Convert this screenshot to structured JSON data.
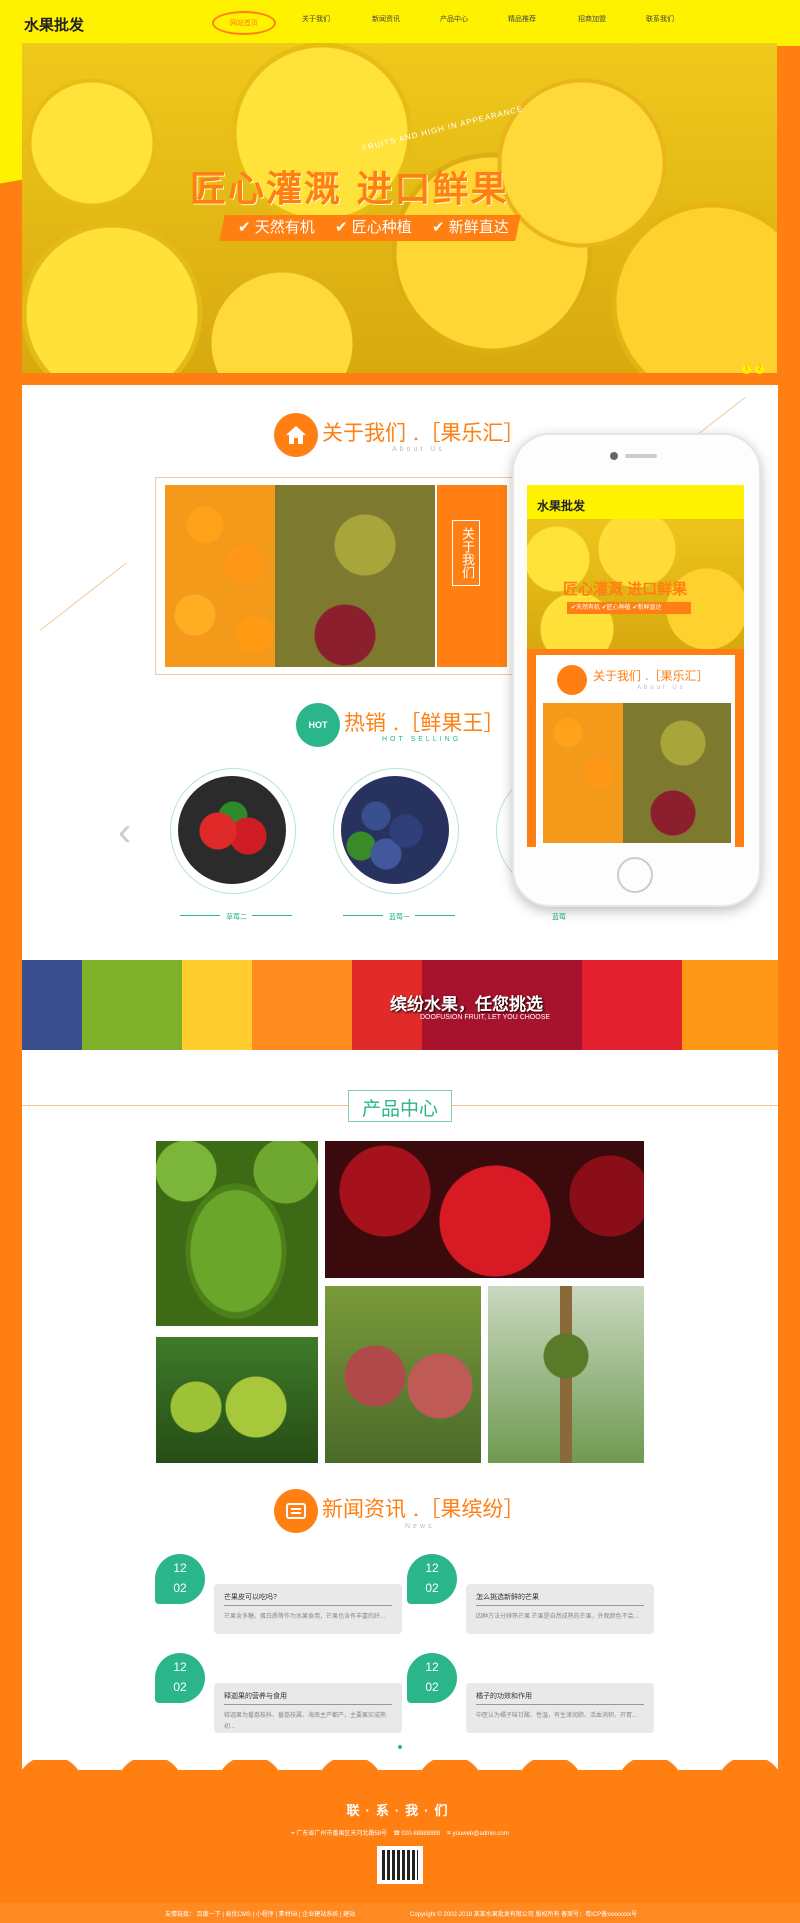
{
  "header": {
    "logo": "水果批发",
    "nav": [
      "网站首页",
      "关于我们",
      "新闻资讯",
      "产品中心",
      "精品推荐",
      "招商加盟",
      "联系我们"
    ]
  },
  "hero": {
    "title": "匠心灌溉 进口鲜果",
    "features": [
      "天然有机",
      "匠心种植",
      "新鲜直达"
    ],
    "english": "FRUITS AND HIGH IN APPEARANCE",
    "dots": [
      "1",
      "2"
    ]
  },
  "about": {
    "title": "关于我们 .［果乐汇］",
    "english": "About Us",
    "side_title": "关于我们"
  },
  "phone": {
    "logo": "水果批发",
    "hero_title": "匠心灌溉 进口鲜果",
    "hero_features": [
      "天然有机",
      "匠心种植",
      "新鲜直达"
    ],
    "about_title": "关于我们 .［果乐汇］",
    "about_en": "About Us"
  },
  "hot": {
    "title": "热销 .［鲜果王］",
    "english": "HOT SELLING",
    "icon_text": "HOT",
    "items": [
      {
        "name": "草莓二"
      },
      {
        "name": "蓝莓一"
      },
      {
        "name": "蓝莓"
      }
    ]
  },
  "banner": {
    "title": "缤纷水果，任您挑选",
    "english": "DOOFUSION FRUIT, LET YOU CHOOSE"
  },
  "products": {
    "title": "产品中心"
  },
  "news": {
    "title": "新闻资讯 .［果缤纷］",
    "english": "News",
    "items": [
      {
        "month": "12",
        "day": "02",
        "title": "芒果皮可以吃吗?",
        "desc": "芒果含多糖、蛋白质等作为水果食用，芒果也含有丰富的纤..."
      },
      {
        "month": "12",
        "day": "02",
        "title": "怎么挑选新鲜的芒果",
        "desc": "四种方法分辨熟芒果 芒果是自然成熟的芒果，外观颜色不会..."
      },
      {
        "month": "12",
        "day": "02",
        "title": "释迦果的营养与食用",
        "desc": "释迦果为番荔枝科、番荔枝属、海南主产都产，主要果实成熟初..."
      },
      {
        "month": "12",
        "day": "02",
        "title": "橘子的功效和作用",
        "desc": "中医认为橘子味甘酸、性温，有生津润肺、活血消积、开胃..."
      }
    ]
  },
  "footer": {
    "title": "联·系·我·们",
    "address": "广东省广州市番禺区天河北路58号",
    "phone": "020-88888888",
    "email": "youweb@admin.com",
    "links": "友情链接： 百度一下 | 易优CMS | 小程序 | 素材58 | 企业建站系统 | 建站",
    "copyright": "Copyright © 2002-2018 某某水果批发有限公司 版权所有 备案号：粤ICP备xxxxxxxx号"
  }
}
